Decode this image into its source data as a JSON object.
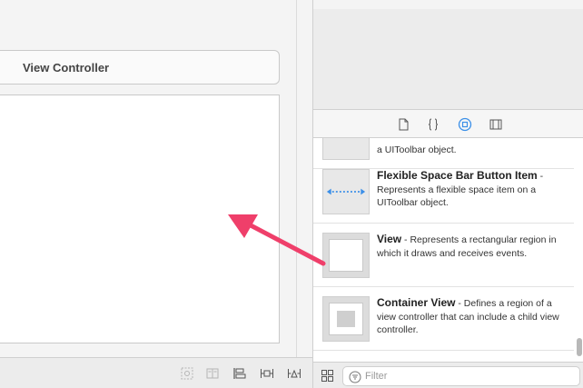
{
  "canvas": {
    "scene_title": "View Controller"
  },
  "inspector_tabs": [
    {
      "icon": "file-icon",
      "active": false
    },
    {
      "icon": "braces-icon",
      "active": false
    },
    {
      "icon": "object-library-icon",
      "active": true
    },
    {
      "icon": "media-library-icon",
      "active": false
    }
  ],
  "library": {
    "items": [
      {
        "title": "",
        "description": "a UIToolbar object.",
        "icon": "toolbar-item-thumb"
      },
      {
        "title": "Flexible Space Bar Button Item",
        "description": " - Represents a flexible space item on a UIToolbar object.",
        "icon": "flexible-space-thumb"
      },
      {
        "title": "View",
        "description": " - Represents a rectangular region in which it draws and receives events.",
        "icon": "view-thumb"
      },
      {
        "title": "Container View",
        "description": " - Defines a region of a view controller that can include a child view controller.",
        "icon": "container-view-thumb"
      }
    ]
  },
  "filter": {
    "placeholder": "Filter",
    "value": ""
  },
  "colors": {
    "accent": "#3b8fe8",
    "annotation": "#ef3f6a"
  }
}
